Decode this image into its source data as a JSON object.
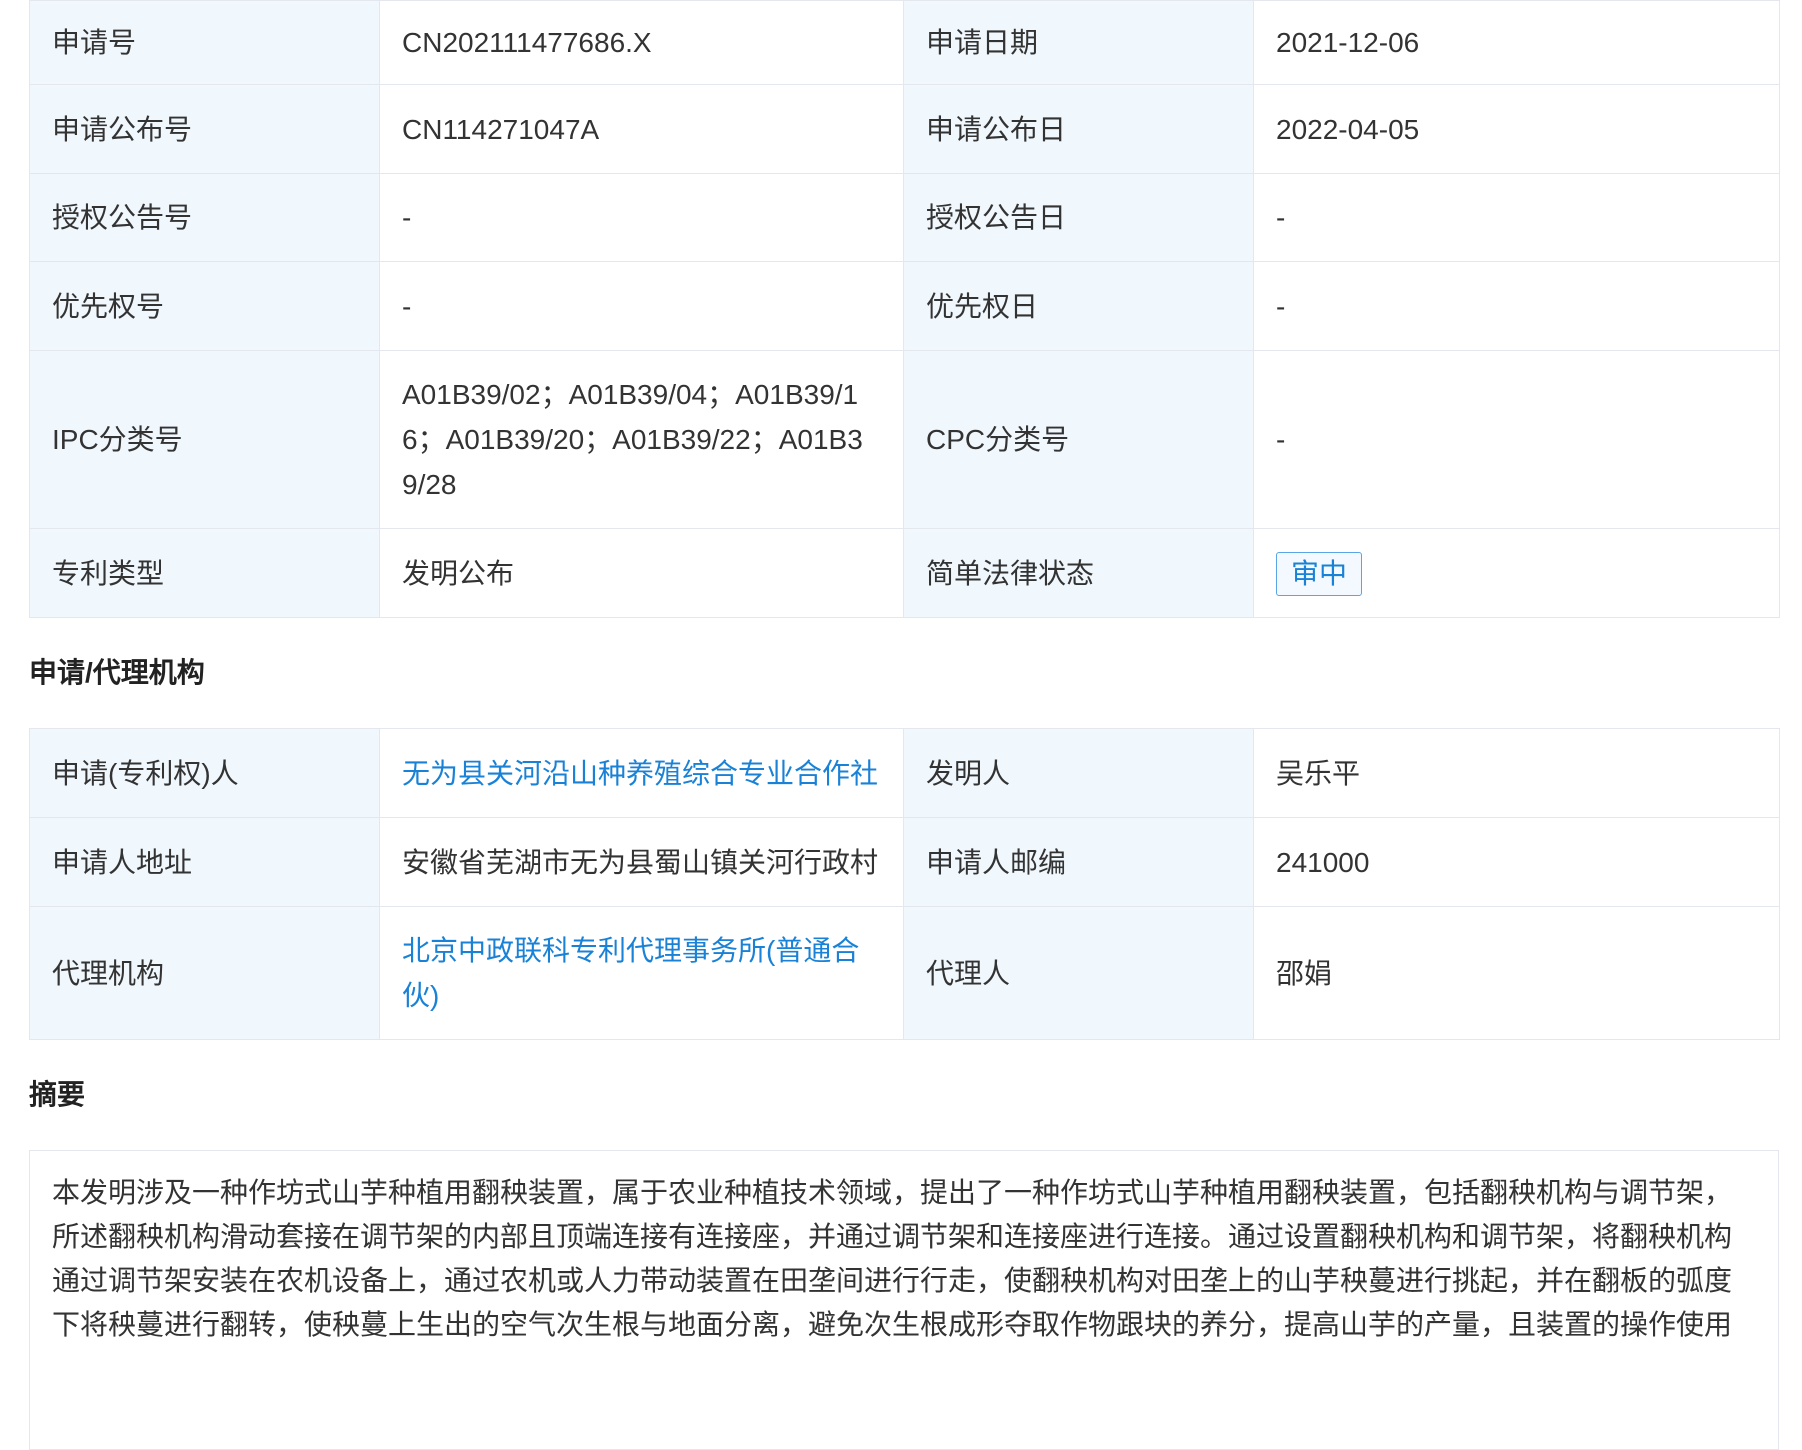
{
  "basic_info": {
    "rows": [
      {
        "label1": "申请号",
        "value1": "CN202111477686.X",
        "label2": "申请日期",
        "value2": "2021-12-06"
      },
      {
        "label1": "申请公布号",
        "value1": "CN114271047A",
        "label2": "申请公布日",
        "value2": "2022-04-05"
      },
      {
        "label1": "授权公告号",
        "value1": "-",
        "label2": "授权公告日",
        "value2": "-"
      },
      {
        "label1": "优先权号",
        "value1": "-",
        "label2": "优先权日",
        "value2": "-"
      },
      {
        "label1": "IPC分类号",
        "value1": "A01B39/02；A01B39/04；A01B39/16；A01B39/20；A01B39/22；A01B39/28",
        "label2": "CPC分类号",
        "value2": "-"
      },
      {
        "label1": "专利类型",
        "value1": "发明公布",
        "label2": "简单法律状态",
        "value2": "审中"
      }
    ]
  },
  "agency_section": {
    "title": "申请/代理机构",
    "rows": [
      {
        "label1": "申请(专利权)人",
        "value1": "无为县关河沿山种养殖综合专业合作社",
        "label2": "发明人",
        "value2": "吴乐平"
      },
      {
        "label1": "申请人地址",
        "value1": "安徽省芜湖市无为县蜀山镇关河行政村",
        "label2": "申请人邮编",
        "value2": "241000"
      },
      {
        "label1": "代理机构",
        "value1": "北京中政联科专利代理事务所(普通合伙)",
        "label2": "代理人",
        "value2": "邵娟"
      }
    ]
  },
  "abstract_section": {
    "title": "摘要",
    "text": "本发明涉及一种作坊式山芋种植用翻秧装置，属于农业种植技术领域，提出了一种作坊式山芋种植用翻秧装置，包括翻秧机构与调节架，所述翻秧机构滑动套接在调节架的内部且顶端连接有连接座，并通过调节架和连接座进行连接。通过设置翻秧机构和调节架，将翻秧机构通过调节架安装在农机设备上，通过农机或人力带动装置在田垄间进行行走，使翻秧机构对田垄上的山芋秧蔓进行挑起，并在翻板的弧度下将秧蔓进行翻转，使秧蔓上生出的空气次生根与地面分离，避免次生根成形夺取作物跟块的养分，提高山芋的产量，且装置的操作使用"
  },
  "colors": {
    "label_bg": "#f0f7fd",
    "border": "#e4e7ed",
    "link": "#1a82d6",
    "text": "#333333"
  }
}
